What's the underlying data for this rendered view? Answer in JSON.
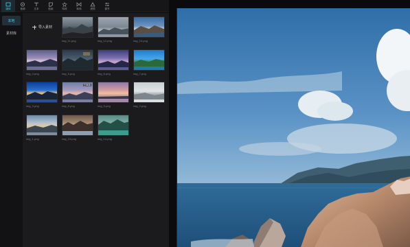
{
  "toolbar": {
    "tabs": [
      {
        "label": "媒体",
        "icon": "media-icon",
        "active": true
      },
      {
        "label": "音频",
        "icon": "audio-icon"
      },
      {
        "label": "文本",
        "icon": "text-icon"
      },
      {
        "label": "贴纸",
        "icon": "sticker-icon"
      },
      {
        "label": "特效",
        "icon": "effects-icon"
      },
      {
        "label": "转场",
        "icon": "transition-icon"
      },
      {
        "label": "滤镜",
        "icon": "filter-icon"
      },
      {
        "label": "调节",
        "icon": "adjust-icon"
      }
    ]
  },
  "sidebar": {
    "items": [
      {
        "label": "本地",
        "active": true
      },
      {
        "label": "素材库"
      }
    ]
  },
  "panel": {
    "import_label": "导入素材",
    "media": [
      {
        "name": "img_11.png",
        "badge": ""
      },
      {
        "name": "img_12.png",
        "badge": ""
      },
      {
        "name": "img_10.png",
        "badge": ""
      },
      {
        "name": "img_4.png",
        "badge": ""
      },
      {
        "name": "img_5.png",
        "badge": ""
      },
      {
        "name": "img_6.png",
        "badge": ""
      },
      {
        "name": "img_7.png",
        "badge": ""
      },
      {
        "name": "img_3.png",
        "badge": ""
      },
      {
        "name": "img_8.png",
        "badge": "已添加"
      },
      {
        "name": "img_9.png",
        "badge": ""
      },
      {
        "name": "img_2.png",
        "badge": ""
      },
      {
        "name": "img_1.png",
        "badge": ""
      },
      {
        "name": "img_13.png",
        "badge": ""
      },
      {
        "name": "img_14.png",
        "badge": ""
      }
    ]
  }
}
